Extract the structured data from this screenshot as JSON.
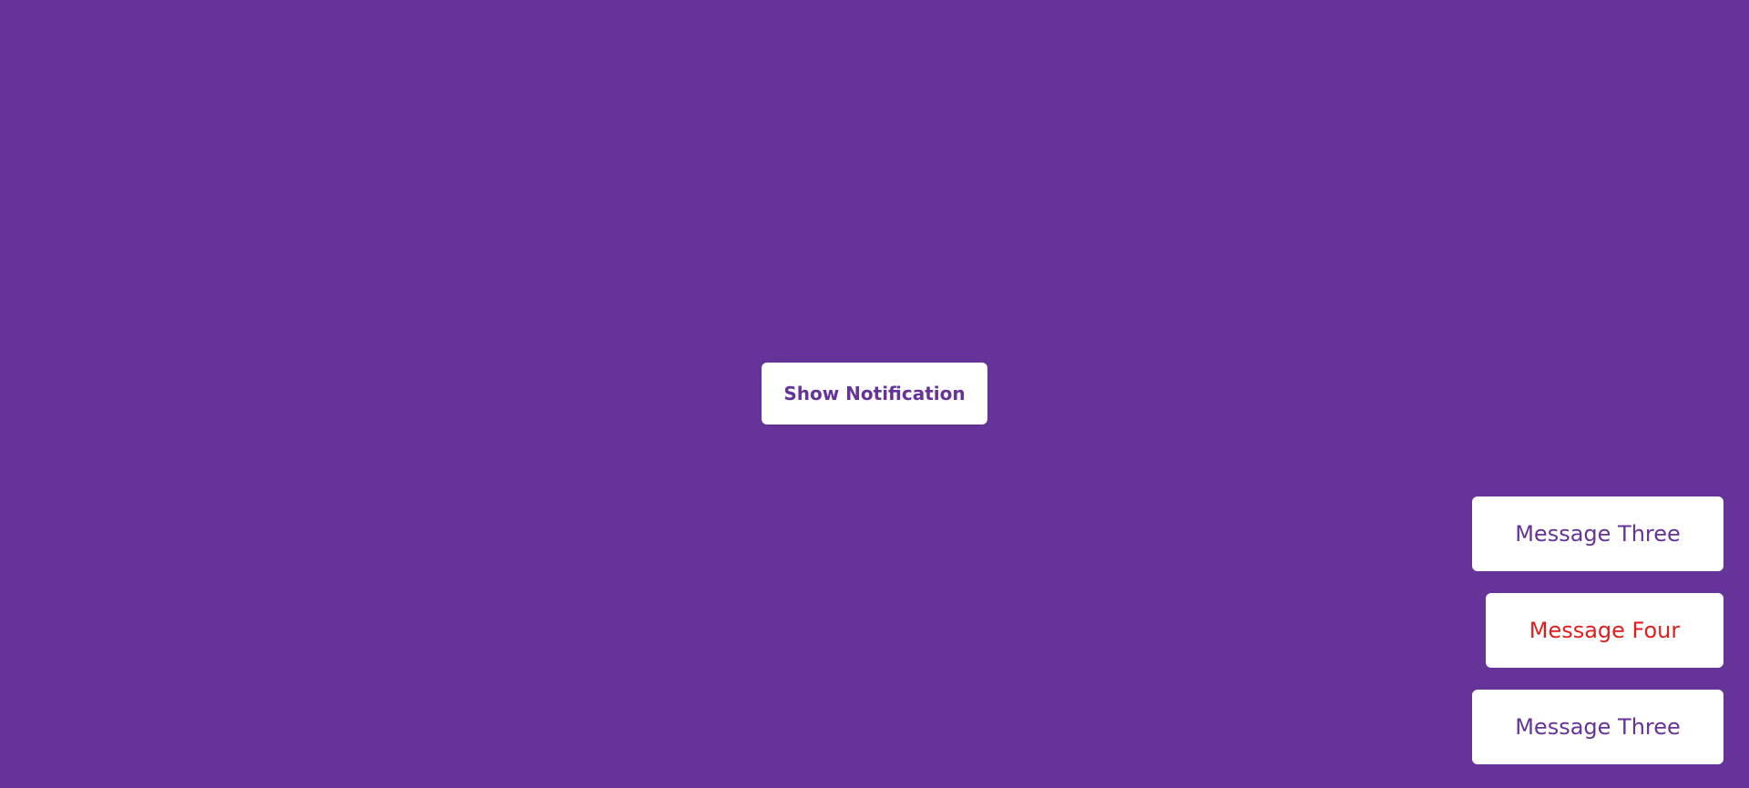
{
  "colors": {
    "background": "#663399",
    "button_bg": "#ffffff",
    "info_text": "#663399",
    "error_text": "#e11d1d"
  },
  "main": {
    "button_label": "Show Notification"
  },
  "notifications": [
    {
      "text": "Message Three",
      "type": "info"
    },
    {
      "text": "Message Four",
      "type": "error"
    },
    {
      "text": "Message Three",
      "type": "info"
    }
  ]
}
